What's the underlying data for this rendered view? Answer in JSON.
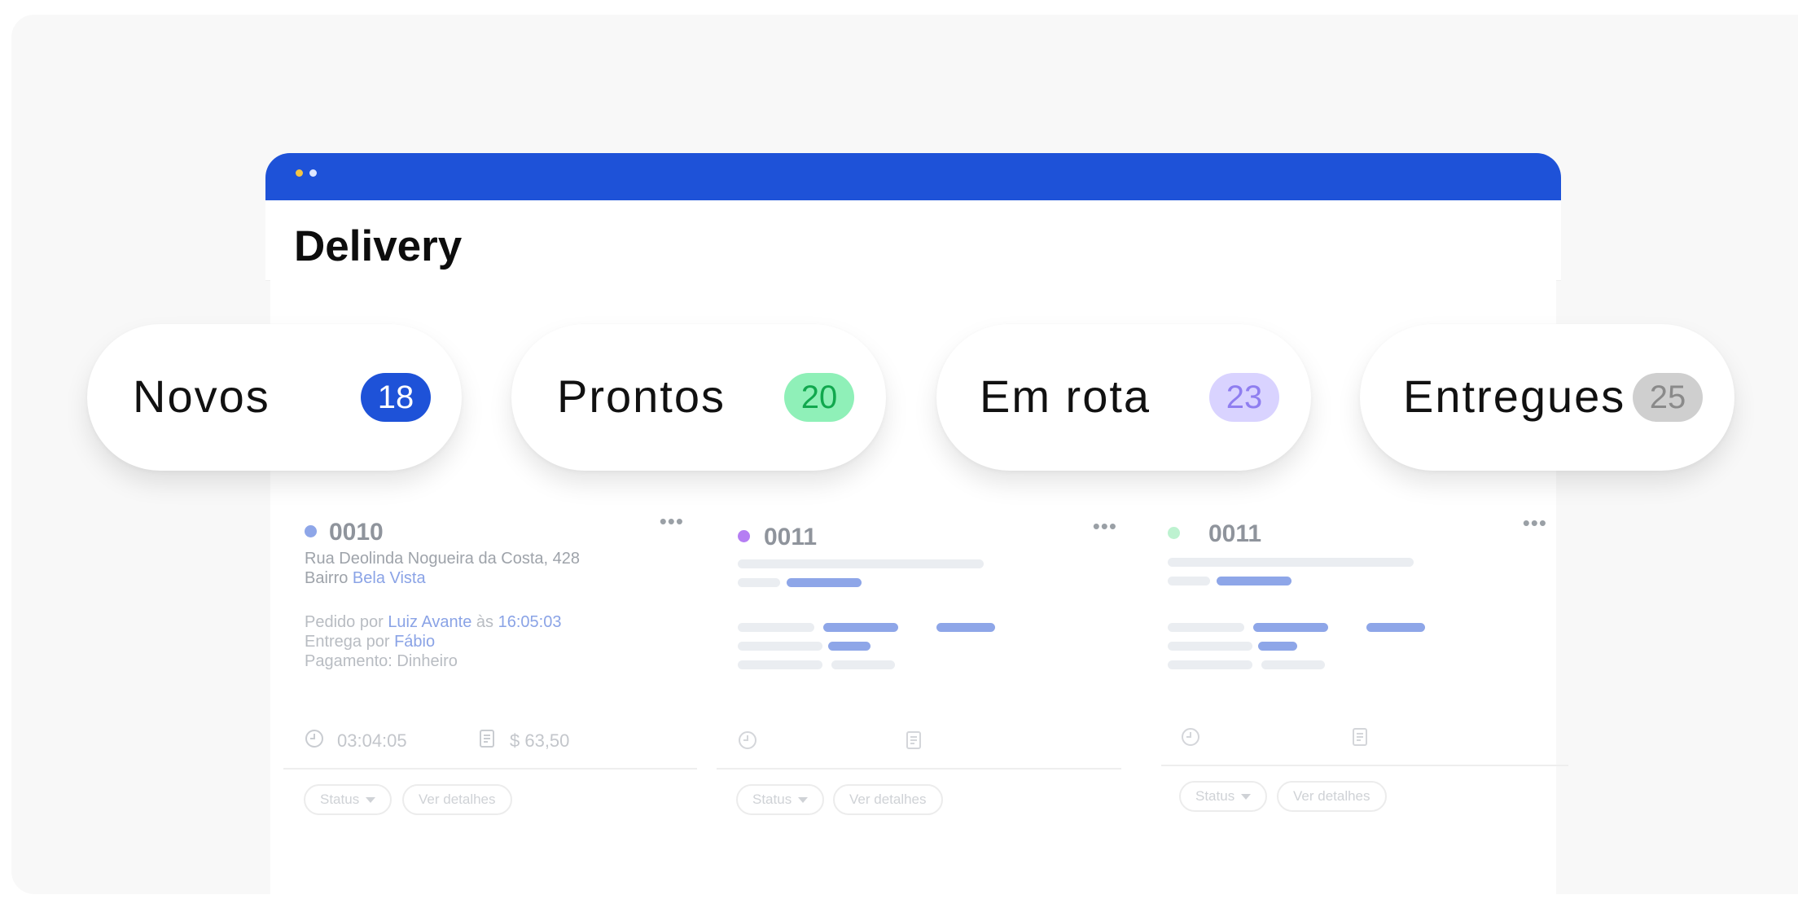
{
  "app": {
    "title": "Delivery"
  },
  "categories": [
    {
      "label": "Novos",
      "count": "18",
      "badge_bg": "#1e52d8",
      "badge_fg": "#ffffff"
    },
    {
      "label": "Prontos",
      "count": "20",
      "badge_bg": "#8ff0b8",
      "badge_fg": "#11a84e"
    },
    {
      "label": "Em rota",
      "count": "23",
      "badge_bg": "#d9d3ff",
      "badge_fg": "#8f7ef0"
    },
    {
      "label": "Entregues",
      "count": "25",
      "badge_bg": "#cfcfcf",
      "badge_fg": "#8a8a8a"
    }
  ],
  "orders": [
    {
      "number": "0010",
      "status_color": "#8ea6e8",
      "address": "Rua Deolinda Nogueira da Costa, 428",
      "district_prefix": "Bairro",
      "district": "Bela Vista",
      "ordered_by_prefix": "Pedido por",
      "ordered_by": "Luiz Avante",
      "time_prefix": "às",
      "time": "16:05:03",
      "delivered_by_prefix": "Entrega por",
      "delivered_by": "Fábio",
      "payment": "Pagamento: Dinheiro",
      "elapsed": "03:04:05",
      "total": "$ 63,50",
      "status_label": "Status",
      "details_label": "Ver detalhes"
    },
    {
      "number": "0011",
      "status_color": "#b57ef3",
      "status_label": "Status",
      "details_label": "Ver detalhes"
    },
    {
      "number": "0011",
      "status_color": "#bdf2d0",
      "status_label": "Status",
      "details_label": "Ver detalhes"
    }
  ],
  "icons": {
    "menu": "ellipsis-icon",
    "clock": "clock-icon",
    "receipt": "receipt-icon"
  }
}
